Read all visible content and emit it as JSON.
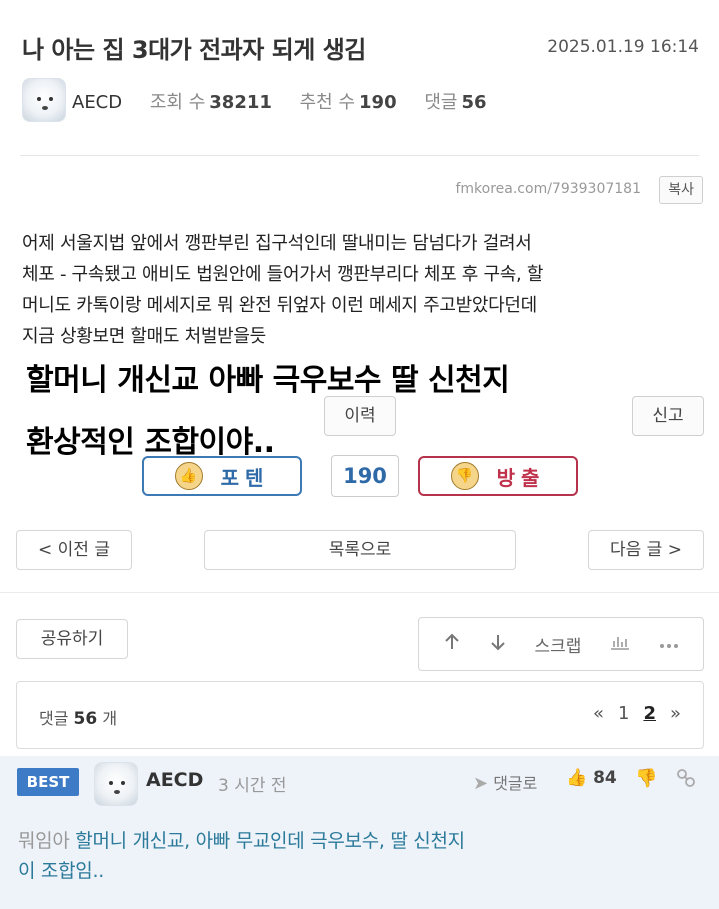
{
  "post": {
    "title": "나 아는 집 3대가 전과자 되게 생김",
    "date": "2025.01.19 16:14",
    "author": "AECD",
    "views_label": "조회 수",
    "views": "38211",
    "recommend_label": "추천 수",
    "recommend": "190",
    "comments_label": "댓글",
    "comments": "56",
    "url": "fmkorea.com/7939307181",
    "copy_label": "복사",
    "body_lines": [
      "어제 서울지법 앞에서 깽판부린 집구석인데 딸내미는 담넘다가 걸려서",
      "체포 - 구속됐고 애비도 법원안에 들어가서 깽판부리다 체포 후 구속, 할",
      "머니도 카톡이랑 메세지로 뭐 완전 뒤엎자 이런 메세지 주고받았다던데",
      "지금 상황보면 할매도 처벌받을듯"
    ],
    "overlay_line1": "할머니 개신교 아빠 극우보수 딸 신천지",
    "overlay_line2": "환상적인 조합이야..",
    "history_label": "이력",
    "report_label": "신고"
  },
  "vote": {
    "up_label": "포텐",
    "count": "190",
    "down_label": "방출"
  },
  "nav": {
    "prev_label": "< 이전 글",
    "list_label": "목록으로",
    "next_label": "다음 글 >"
  },
  "toolbar": {
    "share_label": "공유하기",
    "scrap_label": "스크랩",
    "up_icon": "arrow-up-icon",
    "down_icon": "arrow-down-icon",
    "chart_icon": "chart-icon",
    "more_icon": "more-icon"
  },
  "comments": {
    "label": "댓글",
    "count": "56",
    "unit": "개",
    "pager_prev": "«",
    "pages": [
      "1",
      "2"
    ],
    "current_page": "2",
    "pager_next": "»"
  },
  "best_comment": {
    "badge": "BEST",
    "author": "AECD",
    "time": "3 시간 전",
    "reply_label": "댓글로",
    "likes": "84",
    "prefix": "뭐임아",
    "text_line1": "할머니 개신교, 아빠 무교인데 극우보수, 딸 신천지",
    "text_line2": "이 조합임.."
  },
  "colors": {
    "accent_blue": "#3e7bc6",
    "down_red": "#c0314c",
    "comment_text": "#2b7a9a",
    "best_bg": "#eef3fa"
  }
}
